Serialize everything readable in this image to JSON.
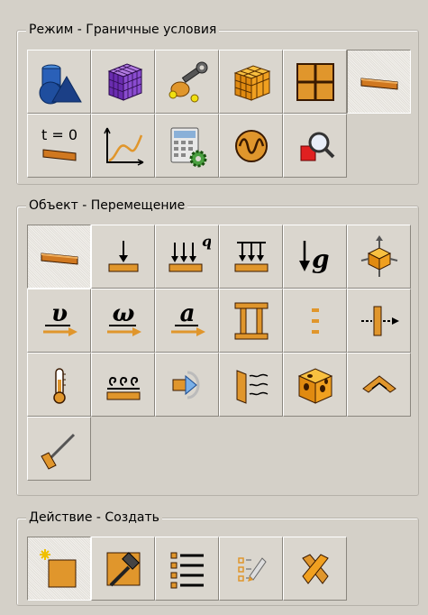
{
  "groups": {
    "mode": {
      "title": "Режим - Граничные условия",
      "buttons": [
        {
          "icon": "part-shapes-icon"
        },
        {
          "icon": "mesh-cube-icon"
        },
        {
          "icon": "tools-wrench-icon"
        },
        {
          "icon": "orange-cube-icon"
        },
        {
          "icon": "grid-frame-icon"
        },
        {
          "icon": "beam-plate-icon",
          "active": true
        },
        {
          "icon": "initial-condition-icon",
          "label": "t = 0"
        },
        {
          "icon": "curve-graph-icon"
        },
        {
          "icon": "calculator-gear-icon"
        },
        {
          "icon": "wave-signal-icon"
        },
        {
          "icon": "query-magnifier-icon"
        }
      ]
    },
    "object": {
      "title": "Объект - Перемещение",
      "buttons": [
        {
          "icon": "plate-icon",
          "active": true
        },
        {
          "icon": "point-load-icon"
        },
        {
          "icon": "distributed-load-icon",
          "label": "q"
        },
        {
          "icon": "pressure-load-icon"
        },
        {
          "icon": "gravity-icon",
          "label": "g"
        },
        {
          "icon": "inertia-icon"
        },
        {
          "icon": "velocity-icon",
          "label": "υ"
        },
        {
          "icon": "angular-velocity-icon",
          "label": "ω"
        },
        {
          "icon": "acceleration-icon",
          "label": "a"
        },
        {
          "icon": "frame-support-icon"
        },
        {
          "icon": "gap-icon"
        },
        {
          "icon": "split-arrow-icon"
        },
        {
          "icon": "thermometer-icon"
        },
        {
          "icon": "heat-flux-icon"
        },
        {
          "icon": "flow-arrow-icon"
        },
        {
          "icon": "convection-icon"
        },
        {
          "icon": "material-block-icon"
        },
        {
          "icon": "radiation-icon"
        },
        {
          "icon": "angle-support-icon"
        }
      ]
    },
    "action": {
      "title": "Действие - Создать",
      "buttons": [
        {
          "icon": "create-new-icon",
          "active": true
        },
        {
          "icon": "edit-hammer-icon"
        },
        {
          "icon": "list-icon"
        },
        {
          "icon": "modify-pencil-icon"
        },
        {
          "icon": "delete-x-icon"
        }
      ]
    }
  },
  "colors": {
    "orange": "#e0962c",
    "dark": "#1a1a1a",
    "blue": "#2856a8"
  }
}
